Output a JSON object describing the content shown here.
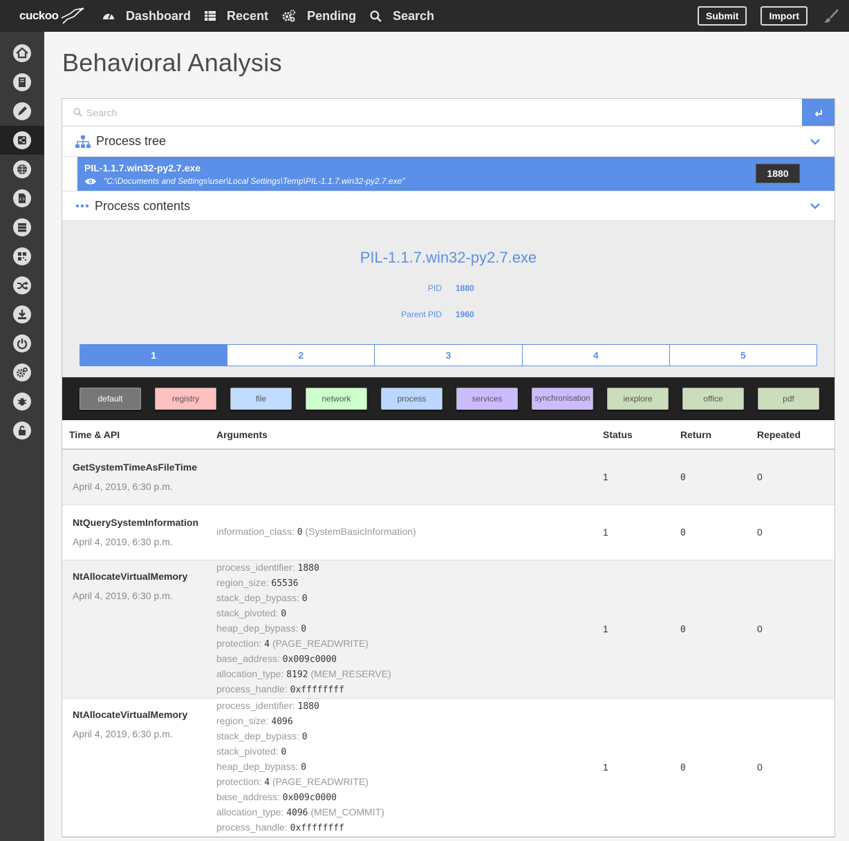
{
  "brand": {
    "name": "cuckoo"
  },
  "nav": [
    {
      "label": "Dashboard",
      "icon": "dashboard-icon"
    },
    {
      "label": "Recent",
      "icon": "table-icon"
    },
    {
      "label": "Pending",
      "icon": "gears-icon"
    },
    {
      "label": "Search",
      "icon": "search-icon"
    }
  ],
  "topbar": {
    "submit_label": "Submit",
    "import_label": "Import"
  },
  "sidebar": [
    {
      "icon": "home-icon"
    },
    {
      "icon": "book-icon"
    },
    {
      "icon": "pencil-icon"
    },
    {
      "icon": "share-icon",
      "active": true
    },
    {
      "icon": "globe-icon"
    },
    {
      "icon": "file-code-icon"
    },
    {
      "icon": "server-icon"
    },
    {
      "icon": "qrcode-icon"
    },
    {
      "icon": "shuffle-icon"
    },
    {
      "icon": "download-icon"
    },
    {
      "icon": "power-icon"
    },
    {
      "icon": "cogs-icon"
    },
    {
      "icon": "bug-icon"
    },
    {
      "icon": "unlock-icon"
    }
  ],
  "page": {
    "title": "Behavioral Analysis"
  },
  "search": {
    "placeholder": "Search"
  },
  "process_tree": {
    "title": "Process tree",
    "process": {
      "name": "PIL-1.1.7.win32-py2.7.exe",
      "path": "\"C:\\Documents and Settings\\user\\Local Settings\\Temp\\PIL-1.1.7.win32-py2.7.exe\"",
      "pid": "1880"
    }
  },
  "process_contents": {
    "title": "Process contents",
    "name": "PIL-1.1.7.win32-py2.7.exe",
    "pid_label": "PID",
    "pid": "1880",
    "ppid_label": "Parent PID",
    "ppid": "1960",
    "pages": [
      "1",
      "2",
      "3",
      "4",
      "5"
    ],
    "active_page": "1"
  },
  "filters": [
    {
      "label": "default",
      "color": "#777777",
      "text": "#ffffff"
    },
    {
      "label": "registry",
      "color": "#ffc0c0",
      "text": "#555555"
    },
    {
      "label": "file",
      "color": "#c0dcff",
      "text": "#555555"
    },
    {
      "label": "network",
      "color": "#ccffcc",
      "text": "#555555"
    },
    {
      "label": "process",
      "color": "#bbd6ff",
      "text": "#555555"
    },
    {
      "label": "services",
      "color": "#ccbbff",
      "text": "#555555"
    },
    {
      "label": "synchronisation",
      "color": "#ccbbff",
      "text": "#555555"
    },
    {
      "label": "iexplore",
      "color": "#ccddbb",
      "text": "#555555"
    },
    {
      "label": "office",
      "color": "#ccddbb",
      "text": "#555555"
    },
    {
      "label": "pdf",
      "color": "#ccddbb",
      "text": "#555555"
    }
  ],
  "table": {
    "headers": {
      "api": "Time & API",
      "args": "Arguments",
      "status": "Status",
      "return": "Return",
      "repeated": "Repeated"
    },
    "rows": [
      {
        "api": "GetSystemTimeAsFileTime",
        "time": "April 4, 2019, 6:30 p.m.",
        "args": [],
        "status": "1",
        "return": "0",
        "repeated": "0"
      },
      {
        "api": "NtQuerySystemInformation",
        "time": "April 4, 2019, 6:30 p.m.",
        "args": [
          {
            "k": "information_class:",
            "v": "0",
            "note": "(SystemBasicInformation)"
          }
        ],
        "status": "1",
        "return": "0",
        "repeated": "0"
      },
      {
        "api": "NtAllocateVirtualMemory",
        "time": "April 4, 2019, 6:30 p.m.",
        "args": [
          {
            "k": "process_identifier:",
            "v": "1880",
            "note": ""
          },
          {
            "k": "region_size:",
            "v": "65536",
            "note": ""
          },
          {
            "k": "stack_dep_bypass:",
            "v": "0",
            "note": ""
          },
          {
            "k": "stack_pivoted:",
            "v": "0",
            "note": ""
          },
          {
            "k": "heap_dep_bypass:",
            "v": "0",
            "note": ""
          },
          {
            "k": "protection:",
            "v": "4",
            "note": "(PAGE_READWRITE)"
          },
          {
            "k": "base_address:",
            "v": "0x009c0000",
            "note": ""
          },
          {
            "k": "allocation_type:",
            "v": "8192",
            "note": "(MEM_RESERVE)"
          },
          {
            "k": "process_handle:",
            "v": "0xffffffff",
            "note": ""
          }
        ],
        "status": "1",
        "return": "0",
        "repeated": "0"
      },
      {
        "api": "NtAllocateVirtualMemory",
        "time": "April 4, 2019, 6:30 p.m.",
        "args": [
          {
            "k": "process_identifier:",
            "v": "1880",
            "note": ""
          },
          {
            "k": "region_size:",
            "v": "4096",
            "note": ""
          },
          {
            "k": "stack_dep_bypass:",
            "v": "0",
            "note": ""
          },
          {
            "k": "stack_pivoted:",
            "v": "0",
            "note": ""
          },
          {
            "k": "heap_dep_bypass:",
            "v": "0",
            "note": ""
          },
          {
            "k": "protection:",
            "v": "4",
            "note": "(PAGE_READWRITE)"
          },
          {
            "k": "base_address:",
            "v": "0x009c0000",
            "note": ""
          },
          {
            "k": "allocation_type:",
            "v": "4096",
            "note": "(MEM_COMMIT)"
          },
          {
            "k": "process_handle:",
            "v": "0xffffffff",
            "note": ""
          }
        ],
        "status": "1",
        "return": "0",
        "repeated": "0"
      }
    ]
  }
}
